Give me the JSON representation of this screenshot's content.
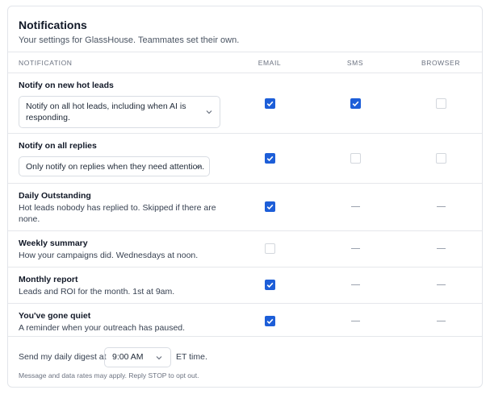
{
  "header": {
    "title": "Notifications",
    "subtitle": "Your settings for GlassHouse. Teammates set their own."
  },
  "columns": {
    "notification": "NOTIFICATION",
    "email": "EMAIL",
    "sms": "SMS",
    "browser": "BROWSER"
  },
  "rows": [
    {
      "title": "Notify on new hot leads",
      "select_value": "Notify on all hot leads, including when AI is responding.",
      "email": true,
      "sms": true,
      "browser": false
    },
    {
      "title": "Notify on all replies",
      "select_value": "Only notify on replies when they need attention.",
      "email": true,
      "sms": false,
      "browser": false
    },
    {
      "title": "Daily Outstanding",
      "description": "Hot leads nobody has replied to. Skipped if there are none.",
      "email": true,
      "sms": null,
      "browser": null
    },
    {
      "title": "Weekly summary",
      "description": "How your campaigns did. Wednesdays at noon.",
      "email": false,
      "sms": null,
      "browser": null
    },
    {
      "title": "Monthly report",
      "description": "Leads and ROI for the month. 1st at 9am.",
      "email": true,
      "sms": null,
      "browser": null
    },
    {
      "title": "You've gone quiet",
      "description": "A reminder when your outreach has paused.",
      "email": true,
      "sms": null,
      "browser": null
    }
  ],
  "footer": {
    "digest_prefix": "Send my daily digest at",
    "digest_time": "9:00 AM",
    "digest_suffix": "ET time.",
    "disclaimer": "Message and data rates may apply. Reply STOP to opt out."
  },
  "colors": {
    "accent": "#1d5ed8",
    "border": "#e5e7eb"
  }
}
